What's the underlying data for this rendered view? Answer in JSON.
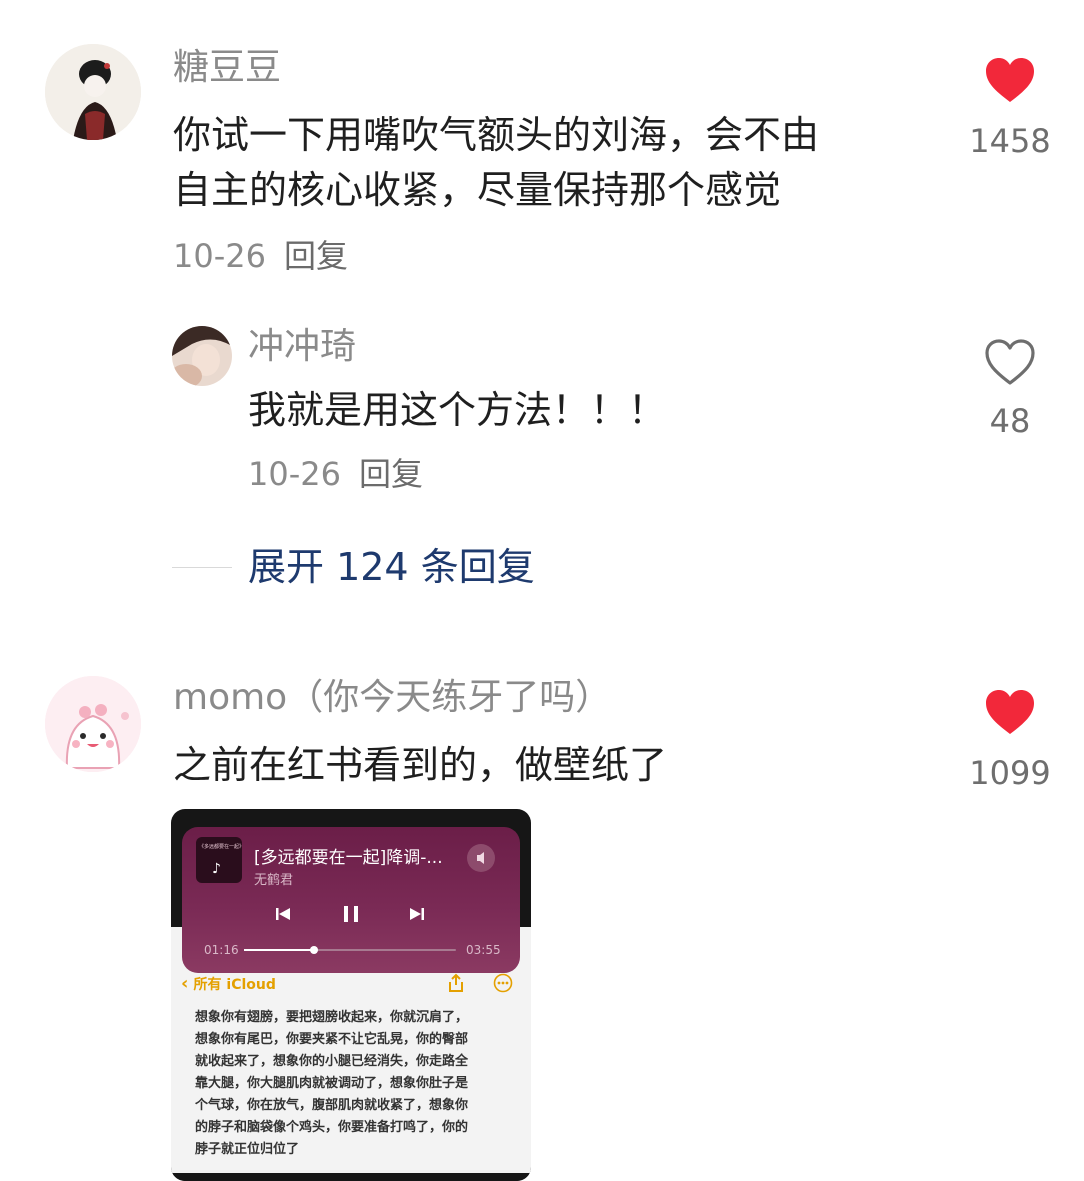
{
  "comments": [
    {
      "username": "糖豆豆",
      "content_line1": "你试一下用嘴吹气额头的刘海，会不由",
      "content_line2": "自主的核心收紧，尽量保持那个感觉",
      "date": "10-26",
      "reply_label": "回复",
      "likes": "1458",
      "liked": true
    },
    {
      "username": "冲冲琦",
      "content": "我就是用这个方法！！！",
      "date": "10-26",
      "reply_label": "回复",
      "likes": "48",
      "liked": false
    },
    {
      "username": "momo（你今天练牙了吗）",
      "content": "之前在红书看到的，做壁纸了",
      "likes": "1099",
      "liked": true
    }
  ],
  "expand_replies": "展开 124 条回复",
  "attached_image": {
    "player": {
      "song_title": "[多远都要在一起]降调-...",
      "artist": "无鹤君",
      "time_elapsed": "01:16",
      "time_total": "03:55",
      "progress": 0.33,
      "cover_text": "《多远都要在一起》"
    },
    "notes": {
      "back_label": "所有 iCloud",
      "lines": [
        "想象你有翅膀，要把翅膀收起来，你就沉肩了，",
        "想象你有尾巴，你要夹紧不让它乱晃，你的臀部",
        "就收起来了，想象你的小腿已经消失，你走路全",
        "靠大腿，你大腿肌肉就被调动了，想象你肚子是",
        "个气球，你在放气，腹部肌肉就收紧了，想象你",
        "的脖子和脑袋像个鸡头，你要准备打鸣了，你的",
        "脖子就正位归位了"
      ]
    }
  },
  "colors": {
    "like_red": "#f2283a",
    "link_blue": "#1e3a6e",
    "player_purple": "#6b1e48"
  }
}
